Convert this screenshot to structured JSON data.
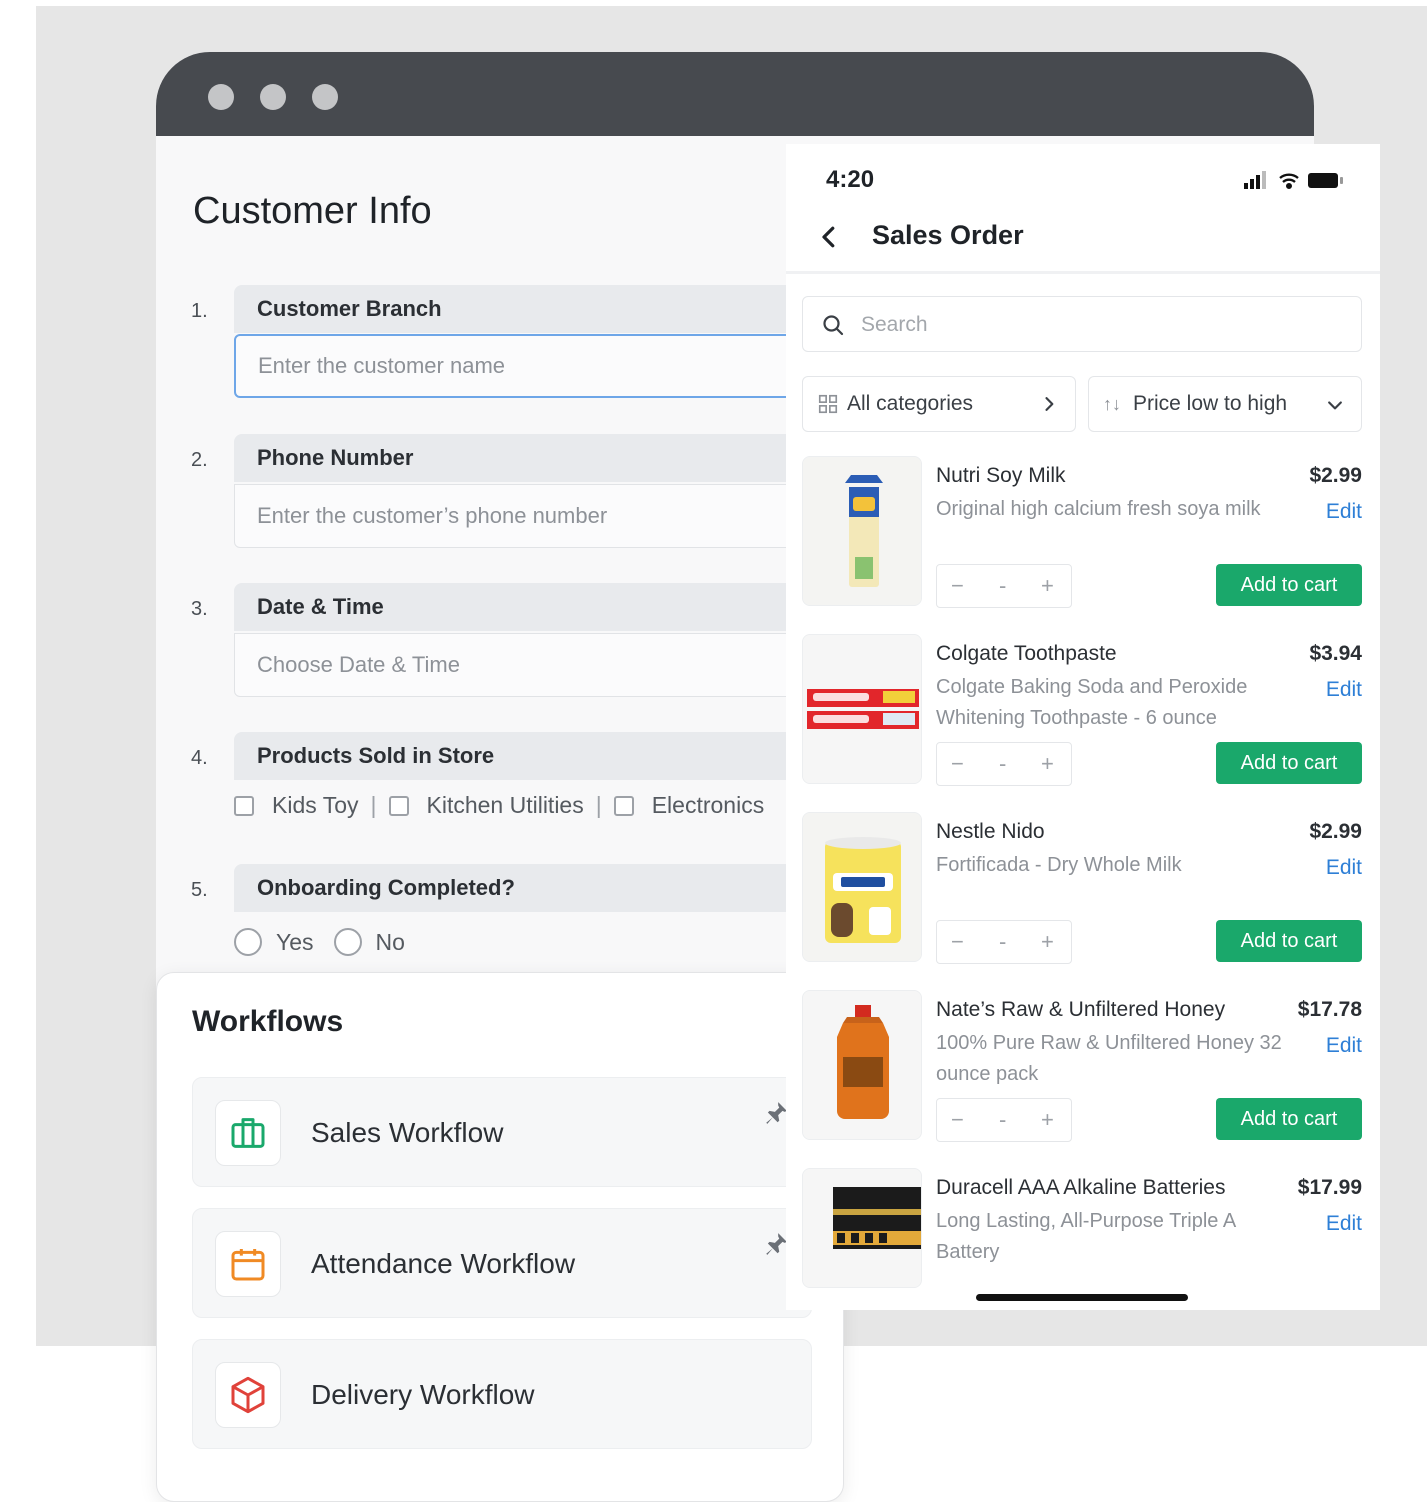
{
  "form": {
    "title": "Customer Info",
    "questions": [
      {
        "num": "1.",
        "label": "Customer Branch",
        "placeholder": "Enter the customer name"
      },
      {
        "num": "2.",
        "label": "Phone Number",
        "placeholder": "Enter the customer’s phone number"
      },
      {
        "num": "3.",
        "label": "Date & Time",
        "placeholder": "Choose Date & Time"
      },
      {
        "num": "4.",
        "label": "Products Sold in Store"
      },
      {
        "num": "5.",
        "label": "Onboarding Completed?"
      }
    ],
    "checkbox_options": [
      "Kids Toy",
      "Kitchen Utilities",
      "Electronics"
    ],
    "checkbox_separator": "|",
    "radio_options": [
      "Yes",
      "No"
    ]
  },
  "workflows": {
    "title": "Workflows",
    "items": [
      {
        "label": "Sales Workflow",
        "icon": "briefcase-icon",
        "color": "#1aa86b",
        "pinned": true
      },
      {
        "label": "Attendance Workflow",
        "icon": "calendar-icon",
        "color": "#f08a24",
        "pinned": true
      },
      {
        "label": "Delivery Workflow",
        "icon": "box-icon",
        "color": "#e0423a",
        "pinned": false
      }
    ]
  },
  "phone": {
    "time": "4:20",
    "nav_title": "Sales Order",
    "search_placeholder": "Search",
    "filter_category": "All categories",
    "filter_sort": "Price low to high",
    "sort_arrows": "↑↓",
    "accent": "#1aa86b",
    "link_color": "#2e7fd6",
    "products": [
      {
        "name": "Nutri Soy Milk",
        "desc": "Original high calcium fresh soya milk",
        "price": "$2.99",
        "edit": "Edit",
        "qty": "-",
        "minus": "−",
        "plus": "+",
        "add": "Add to cart"
      },
      {
        "name": "Colgate Toothpaste",
        "desc": "Colgate Baking Soda and Peroxide Whitening Toothpaste - 6 ounce",
        "price": "$3.94",
        "edit": "Edit",
        "qty": "-",
        "minus": "−",
        "plus": "+",
        "add": "Add to cart"
      },
      {
        "name": "Nestle Nido",
        "desc": "Fortificada - Dry Whole Milk",
        "price": "$2.99",
        "edit": "Edit",
        "qty": "-",
        "minus": "−",
        "plus": "+",
        "add": "Add to cart"
      },
      {
        "name": "Nate’s Raw & Unfiltered Honey",
        "desc": "100% Pure Raw & Unfiltered Honey 32 ounce pack",
        "price": "$17.78",
        "edit": "Edit",
        "qty": "-",
        "minus": "−",
        "plus": "+",
        "add": "Add to cart"
      },
      {
        "name": "Duracell AAA Alkaline Batteries",
        "desc": "Long Lasting, All-Purpose Triple A Battery",
        "price": "$17.99",
        "edit": "Edit"
      }
    ]
  }
}
